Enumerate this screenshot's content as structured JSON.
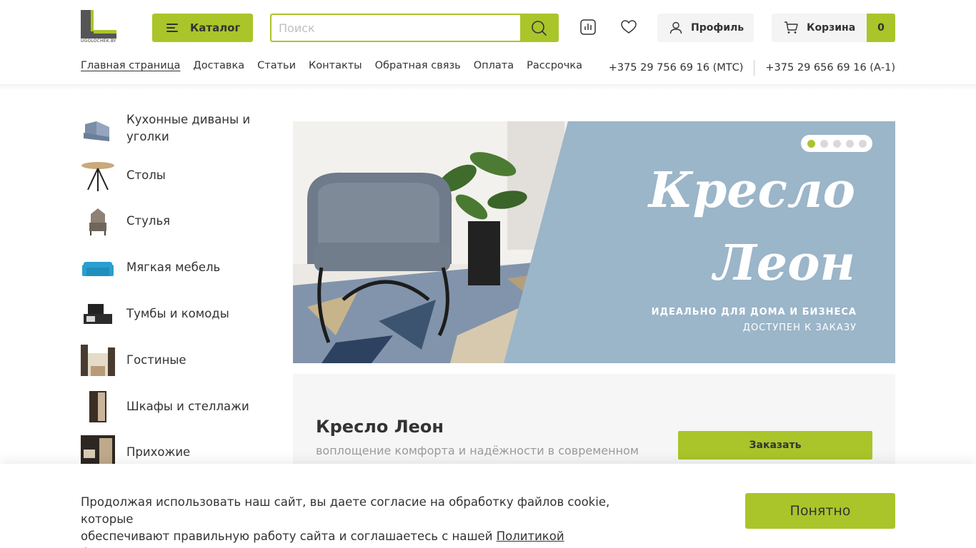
{
  "header": {
    "logo_text": "UGOLOCHEK.BY",
    "catalog_label": "Каталог",
    "search_placeholder": "Поиск",
    "profile_label": "Профиль",
    "cart_label": "Корзина",
    "cart_count": "0"
  },
  "nav": {
    "items": [
      {
        "label": "Главная страница"
      },
      {
        "label": "Доставка"
      },
      {
        "label": "Статьи"
      },
      {
        "label": "Контакты"
      },
      {
        "label": "Обратная связь"
      },
      {
        "label": "Оплата"
      },
      {
        "label": "Рассрочка"
      }
    ],
    "phones": [
      "+375 29 756 69 16 (МТС)",
      "+375 29 656 69 16 (А-1)"
    ]
  },
  "sidebar": {
    "categories": [
      {
        "label": "Кухонные диваны и уголки",
        "icon": "kitchen-sofa-icon"
      },
      {
        "label": "Столы",
        "icon": "table-icon"
      },
      {
        "label": "Стулья",
        "icon": "chair-icon"
      },
      {
        "label": "Мягкая мебель",
        "icon": "sofa-icon"
      },
      {
        "label": "Тумбы и комоды",
        "icon": "tv-stand-icon"
      },
      {
        "label": "Гостиные",
        "icon": "living-room-icon"
      },
      {
        "label": "Шкафы и стеллажи",
        "icon": "wardrobe-icon"
      },
      {
        "label": "Прихожие",
        "icon": "hallway-icon"
      }
    ]
  },
  "banner": {
    "title_line1": "Кресло",
    "title_line2": "Леон",
    "subtitle_line1": "ИДЕАЛЬНО ДЛЯ ДОМА И БИЗНЕСА",
    "subtitle_line2": "ДОСТУПЕН К ЗАКАЗУ",
    "slides_total": 5,
    "active_slide": 1
  },
  "product": {
    "title": "Кресло Леон",
    "description": "воплощение комфорта и надёжности в современном",
    "order_label": "Заказать"
  },
  "cookie": {
    "text_line1": "Продолжая использовать наш сайт, вы даете согласие на обработку файлов cookie, которые",
    "text_line2": "обеспечивают правильную работу сайта и соглашаетесь с нашей ",
    "link_label": "Политикой безопасности",
    "button_label": "Понятно"
  },
  "colors": {
    "accent": "#a9c52a",
    "banner_bg": "#9bb5c9"
  }
}
